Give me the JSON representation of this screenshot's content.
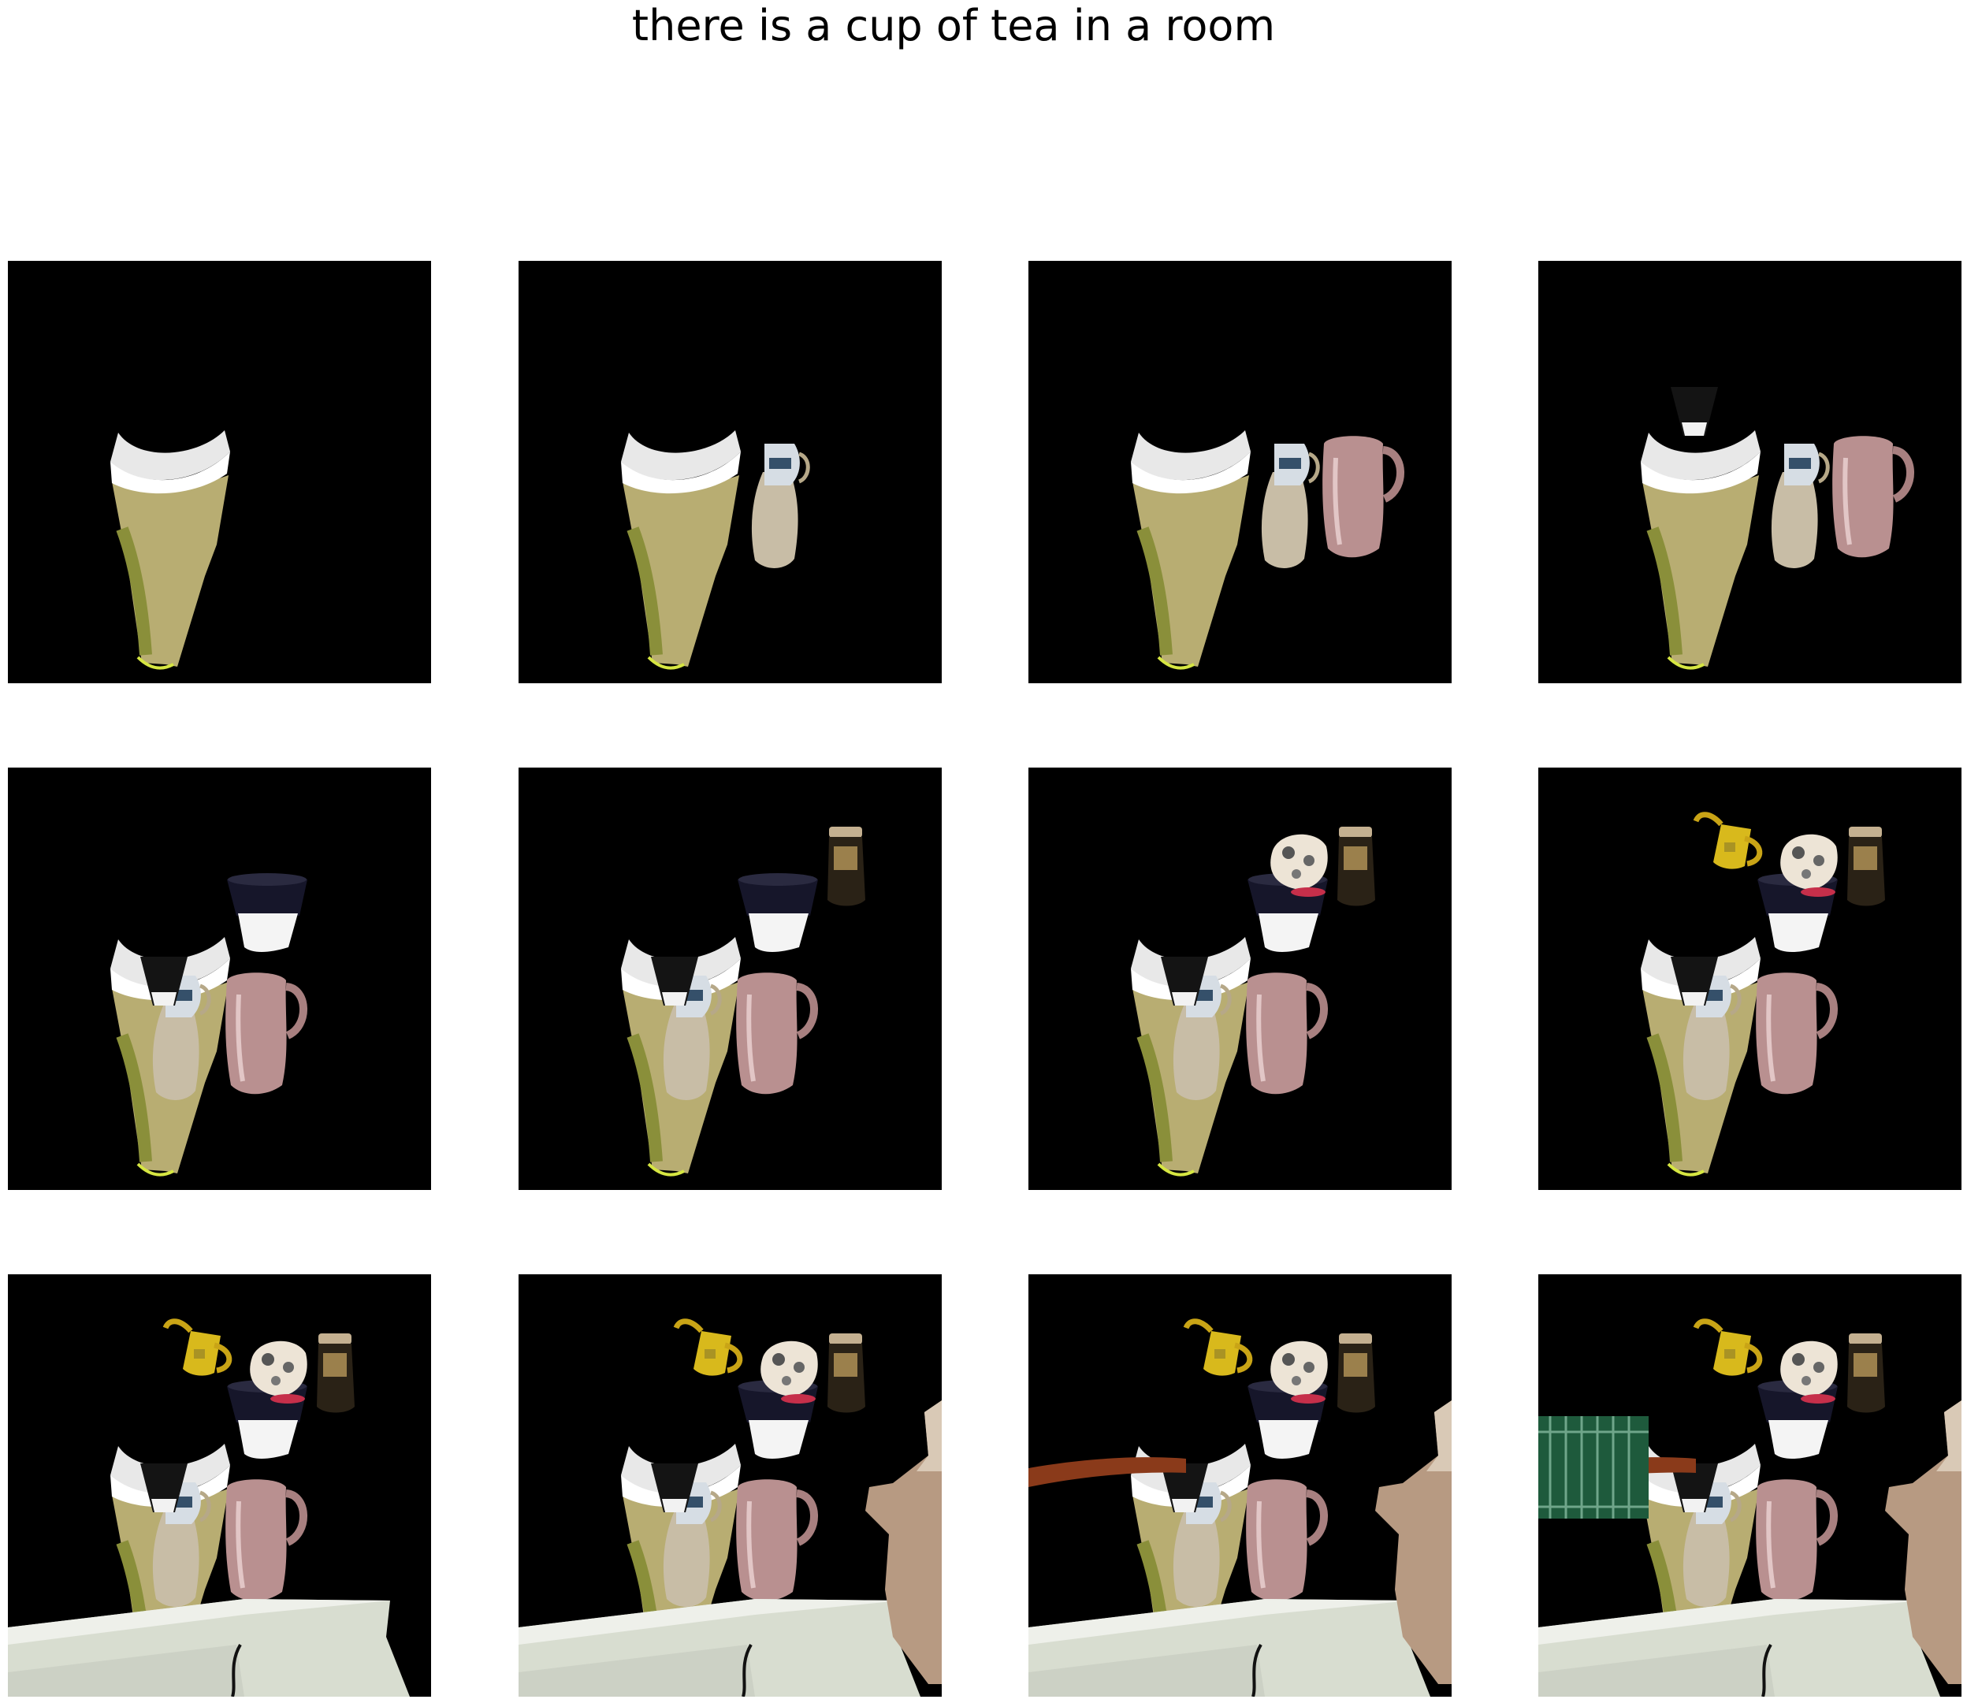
{
  "figure": {
    "title": "there is a cup of tea in a room",
    "layout": {
      "rows": 3,
      "cols": 4
    },
    "background_color": "#000000"
  },
  "panels": [
    {
      "step": 1,
      "objects": [
        "tea-cup"
      ]
    },
    {
      "step": 2,
      "objects": [
        "tea-cup",
        "glass-jug"
      ]
    },
    {
      "step": 3,
      "objects": [
        "tea-cup",
        "glass-jug",
        "pink-pitcher"
      ]
    },
    {
      "step": 4,
      "objects": [
        "tea-cup",
        "glass-jug",
        "pink-pitcher",
        "small-black-cup"
      ]
    },
    {
      "step": 5,
      "objects": [
        "tea-cup",
        "glass-jug",
        "pink-pitcher",
        "small-black-cup",
        "black-bowl"
      ]
    },
    {
      "step": 6,
      "objects": [
        "tea-cup",
        "glass-jug",
        "pink-pitcher",
        "small-black-cup",
        "black-bowl",
        "bottle"
      ]
    },
    {
      "step": 7,
      "objects": [
        "tea-cup",
        "glass-jug",
        "pink-pitcher",
        "small-black-cup",
        "black-bowl",
        "bottle",
        "floral-cup"
      ]
    },
    {
      "step": 8,
      "objects": [
        "tea-cup",
        "glass-jug",
        "pink-pitcher",
        "small-black-cup",
        "black-bowl",
        "bottle",
        "floral-cup",
        "yellow-mug"
      ]
    },
    {
      "step": 9,
      "objects": [
        "tea-cup",
        "glass-jug",
        "pink-pitcher",
        "small-black-cup",
        "black-bowl",
        "bottle",
        "floral-cup",
        "yellow-mug",
        "table"
      ]
    },
    {
      "step": 10,
      "objects": [
        "tea-cup",
        "glass-jug",
        "pink-pitcher",
        "small-black-cup",
        "black-bowl",
        "bottle",
        "floral-cup",
        "yellow-mug",
        "table",
        "stone-wall"
      ]
    },
    {
      "step": 11,
      "objects": [
        "tea-cup",
        "glass-jug",
        "pink-pitcher",
        "small-black-cup",
        "black-bowl",
        "bottle",
        "floral-cup",
        "yellow-mug",
        "table",
        "stone-wall",
        "wooden-rail"
      ]
    },
    {
      "step": 12,
      "objects": [
        "tea-cup",
        "glass-jug",
        "pink-pitcher",
        "small-black-cup",
        "black-bowl",
        "bottle",
        "floral-cup",
        "yellow-mug",
        "table",
        "stone-wall",
        "wooden-rail",
        "green-gate"
      ]
    }
  ]
}
